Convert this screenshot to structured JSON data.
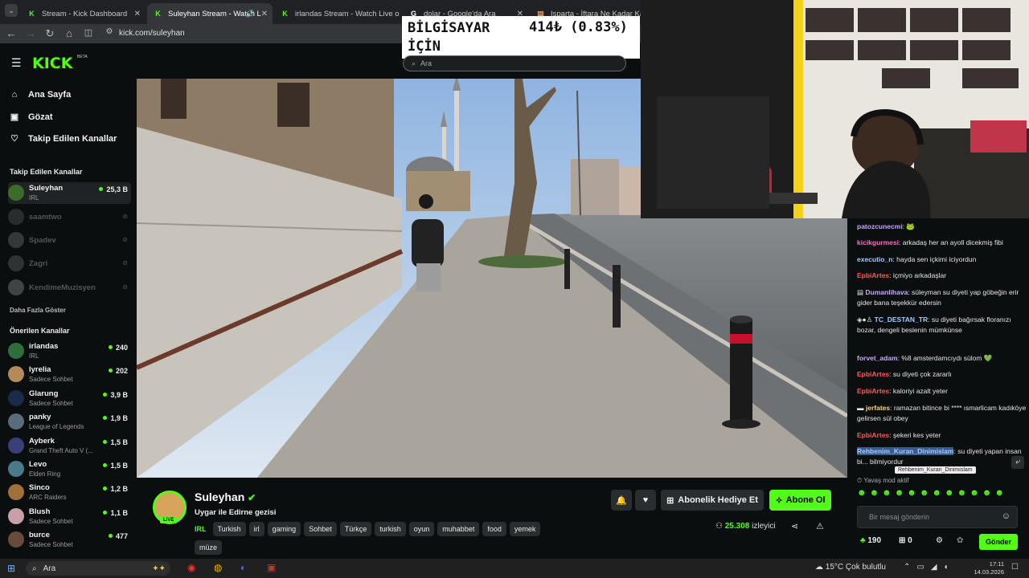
{
  "browser": {
    "tabs": [
      {
        "label": "Stream - Kick Dashboard",
        "icon": "kick-icon"
      },
      {
        "label": "Suleyhan Stream - Watch L",
        "icon": "kick-icon"
      },
      {
        "label": "irlandas Stream - Watch Live o",
        "icon": "kick-icon"
      },
      {
        "label": "dolar - Google'da Ara",
        "icon": "google-icon"
      },
      {
        "label": "Isparta - İftara Ne Kadar Kaldı",
        "icon": "page-icon"
      }
    ],
    "url": "kick.com/suleyhan"
  },
  "google_overlay": {
    "line1": "BİLGİSAYAR",
    "line2": "İÇİN",
    "value": "414₺ (0.83%)",
    "search_placeholder": "Ara"
  },
  "kick": {
    "logo": "KICK",
    "badge": "BETA"
  },
  "sidebar": {
    "nav": [
      {
        "label": "Ana Sayfa",
        "icon": "home-icon"
      },
      {
        "label": "Gözat",
        "icon": "browse-icon"
      },
      {
        "label": "Takip Edilen Kanallar",
        "icon": "heart-icon"
      }
    ],
    "followed_header": "Takip Edilen Kanallar",
    "followed": [
      {
        "name": "Suleyhan",
        "category": "IRL",
        "viewers": "25,3 B"
      },
      {
        "name": "saamtwo"
      },
      {
        "name": "Spadev"
      },
      {
        "name": "Zagri"
      },
      {
        "name": "KendimeMuzisyen"
      }
    ],
    "show_more": "Daha Fazla Göster",
    "recommended_header": "Önerilen Kanallar",
    "recommended": [
      {
        "name": "irlandas",
        "category": "IRL",
        "viewers": "240"
      },
      {
        "name": "lyrelia",
        "category": "Sadece Sohbet",
        "viewers": "202"
      },
      {
        "name": "Glarung",
        "category": "Sadece Sohbet",
        "viewers": "3,9 B"
      },
      {
        "name": "panky",
        "category": "League of Legends",
        "viewers": "1,9 B"
      },
      {
        "name": "Ayberk",
        "category": "Grand Theft Auto V (...",
        "viewers": "1,5 B"
      },
      {
        "name": "Levo",
        "category": "Elden Ring",
        "viewers": "1,5 B"
      },
      {
        "name": "Sinco",
        "category": "ARC Raiders",
        "viewers": "1,2 B"
      },
      {
        "name": "Blush",
        "category": "Sadece Sohbet",
        "viewers": "1,1 B"
      },
      {
        "name": "burce",
        "category": "Sadece Sohbet",
        "viewers": "477"
      }
    ]
  },
  "stream": {
    "streamer": "Suleyhan",
    "title": "Uygar ile Edirne gezisi",
    "live_badge": "LIVE",
    "category": "IRL",
    "tags": [
      "Turkish",
      "irl",
      "gaming",
      "Sohbet",
      "Türkçe",
      "turkish",
      "oyun",
      "muhabbet",
      "food",
      "yemek",
      "müze"
    ],
    "gift_button": "Abonelik Hediye Et",
    "subscribe_button": "Abone Ol",
    "viewer_count": "25.308",
    "viewer_label": "izleyici"
  },
  "chat": {
    "messages": [
      {
        "user": "patozcunecmi",
        "text": "",
        "color": "#c9a7ff"
      },
      {
        "user": "kicikgurmesi",
        "text": "arkadaş her an ayoll dicekmiş fibi",
        "color": "#ff6ec7"
      },
      {
        "user": "executio_n",
        "text": "hayda sen içkimi iciyordun",
        "color": "#9ecbff"
      },
      {
        "user": "EpbiArtes",
        "text": "içmiyo arkadaşlar",
        "color": "#ff5a5a"
      },
      {
        "user": "Dumanlihava",
        "text": "süleyman su diyeti yap göbeğin erir gider bana teşekkür edersin",
        "color": "#c9a7ff"
      },
      {
        "user": "TC_DESTAN_TR",
        "text": "su diyeti bağırsak floranızı bozar, dengeli beslenin mümkünse",
        "color": "#9ecbff"
      },
      {
        "user": "forvet_adam",
        "text": "%8 amsterdamcıydı sülom 💚",
        "color": "#c9a7ff"
      },
      {
        "user": "EpbiArtes",
        "text": "su diyeti çok zararlı",
        "color": "#ff5a5a"
      },
      {
        "user": "EpbiArtes",
        "text": "kaloriyi azalt yeter",
        "color": "#ff5a5a"
      },
      {
        "user": "jerfates",
        "text": "ramazan bitince bi **** ısmarlicam kadıköye gelirsen sül obey",
        "color": "#ffd27a"
      },
      {
        "user": "EpbiArtes",
        "text": "şekeri kes yeter",
        "color": "#ff5a5a"
      },
      {
        "user": "Rehbenim_Kuran_Dinimislam",
        "text": "su diyeti yapan insan bi... bilmiyordur",
        "color": "#9ecbff"
      }
    ],
    "tooltip": "Rehbenim_Kuran_Dinimislam",
    "slow_mode": "Yavaş mod aktif",
    "input_placeholder": "Bir mesaj gönderin",
    "points": "190",
    "gift_count": "0",
    "send_button": "Gönder"
  },
  "taskbar": {
    "search": "Ara",
    "weather_temp": "15°C",
    "weather_text": "Çok bulutlu",
    "time": "17:11",
    "date": "14.03.2026"
  },
  "colors": {
    "kick_green": "#53fc18",
    "bg": "#0b0e0f"
  }
}
